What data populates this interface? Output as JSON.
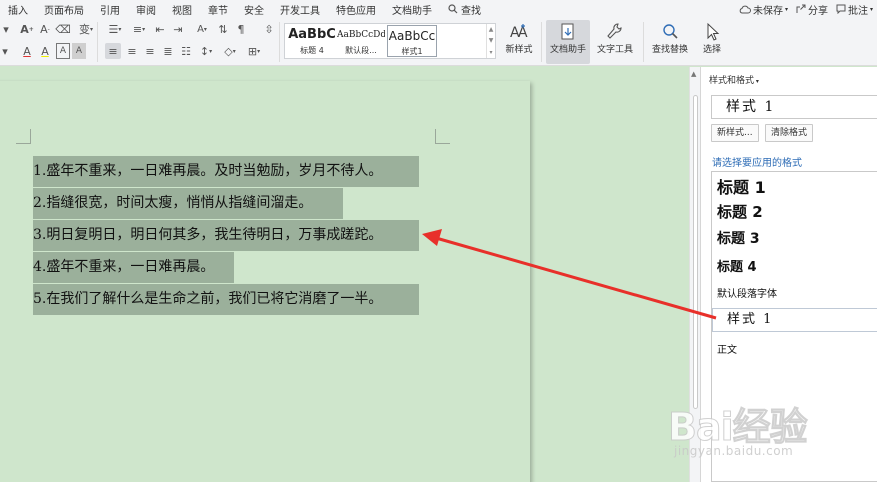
{
  "menubar": {
    "items": [
      "插入",
      "页面布局",
      "引用",
      "审阅",
      "视图",
      "章节",
      "安全",
      "开发工具",
      "特色应用",
      "文档助手"
    ],
    "search_label": "查找",
    "unsaved_label": "未保存",
    "share_label": "分享",
    "comment_label": "批注"
  },
  "ribbon": {
    "style_gallery": [
      {
        "sample": "AaBbC",
        "label": "标题 4"
      },
      {
        "sample": "AaBbCcDd",
        "label": "默认段..."
      },
      {
        "sample": "AaBbCc",
        "label": "样式1"
      }
    ],
    "new_style_label": "新样式",
    "doc_assistant_label": "文档助手",
    "text_tools_label": "文字工具",
    "find_replace_label": "查找替换",
    "select_label": "选择"
  },
  "document": {
    "lines": [
      "1.盛年不重来，一日难再晨。及时当勉励，岁月不待人。",
      "2.指缝很宽，时间太瘦，悄悄从指缝间溜走。",
      "3.明日复明日，明日何其多，我生待明日，万事成蹉跎。",
      "4.盛年不重来，一日难再晨。",
      "5.在我们了解什么是生命之前，我们已将它消磨了一半。"
    ]
  },
  "panel": {
    "title": "样式和格式",
    "current_style": "样式 1",
    "new_style_button": "新样式...",
    "clear_format_button": "清除格式",
    "apply_label": "请选择要应用的格式",
    "styles": [
      "标题 1",
      "标题 2",
      "标题 3",
      "标题 4",
      "默认段落字体",
      "样式 1",
      "正文"
    ]
  },
  "watermark": {
    "logo": "Bai经验",
    "url": "jingyan.baidu.com"
  },
  "colors": {
    "highlight": "#9bb09b",
    "page_bg": "#cfe6cc",
    "arrow": "#e8302a",
    "link_blue": "#2f6db6"
  }
}
